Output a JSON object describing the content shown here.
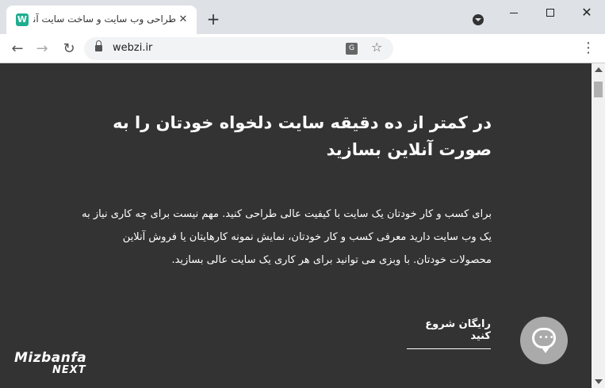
{
  "tab": {
    "favicon_letter": "W",
    "title": "طراحی وب سایت و ساخت سایت آنلاین",
    "close_symbol": "✕",
    "new_tab_symbol": "+"
  },
  "window": {
    "close_symbol": "✕"
  },
  "toolbar": {
    "back_symbol": "←",
    "forward_symbol": "→",
    "reload_symbol": "↻",
    "url": "webzi.ir",
    "translate_symbol": "G",
    "star_symbol": "☆",
    "menu_symbol": "⋮"
  },
  "page": {
    "headline": "در کمتر از ده دقیقه سایت دلخواه خودتان را به صورت آنلاین بسازید",
    "body": "برای کسب و کار خودتان یک سایت با کیفیت عالی طراحی کنید. مهم نیست برای چه کاری نیاز به یک وب سایت دارید معرفی کسب و کار خودتان، نمایش نمونه کارهایتان یا فروش آنلاین محصولات خودتان. با وبزی می توانید برای هر کاری یک سایت عالی بسازید.",
    "cta": "رایگان شروع کنید",
    "logo_main": "Mizbanfa",
    "logo_sub": "NEXT",
    "chat_dots": "•••"
  },
  "icons": {
    "chat": "chat-bubble-icon",
    "lock": "lock-icon",
    "translate": "translate-icon",
    "star": "star-icon",
    "menu": "kebab-menu-icon",
    "tab_search": "tab-search-icon"
  }
}
